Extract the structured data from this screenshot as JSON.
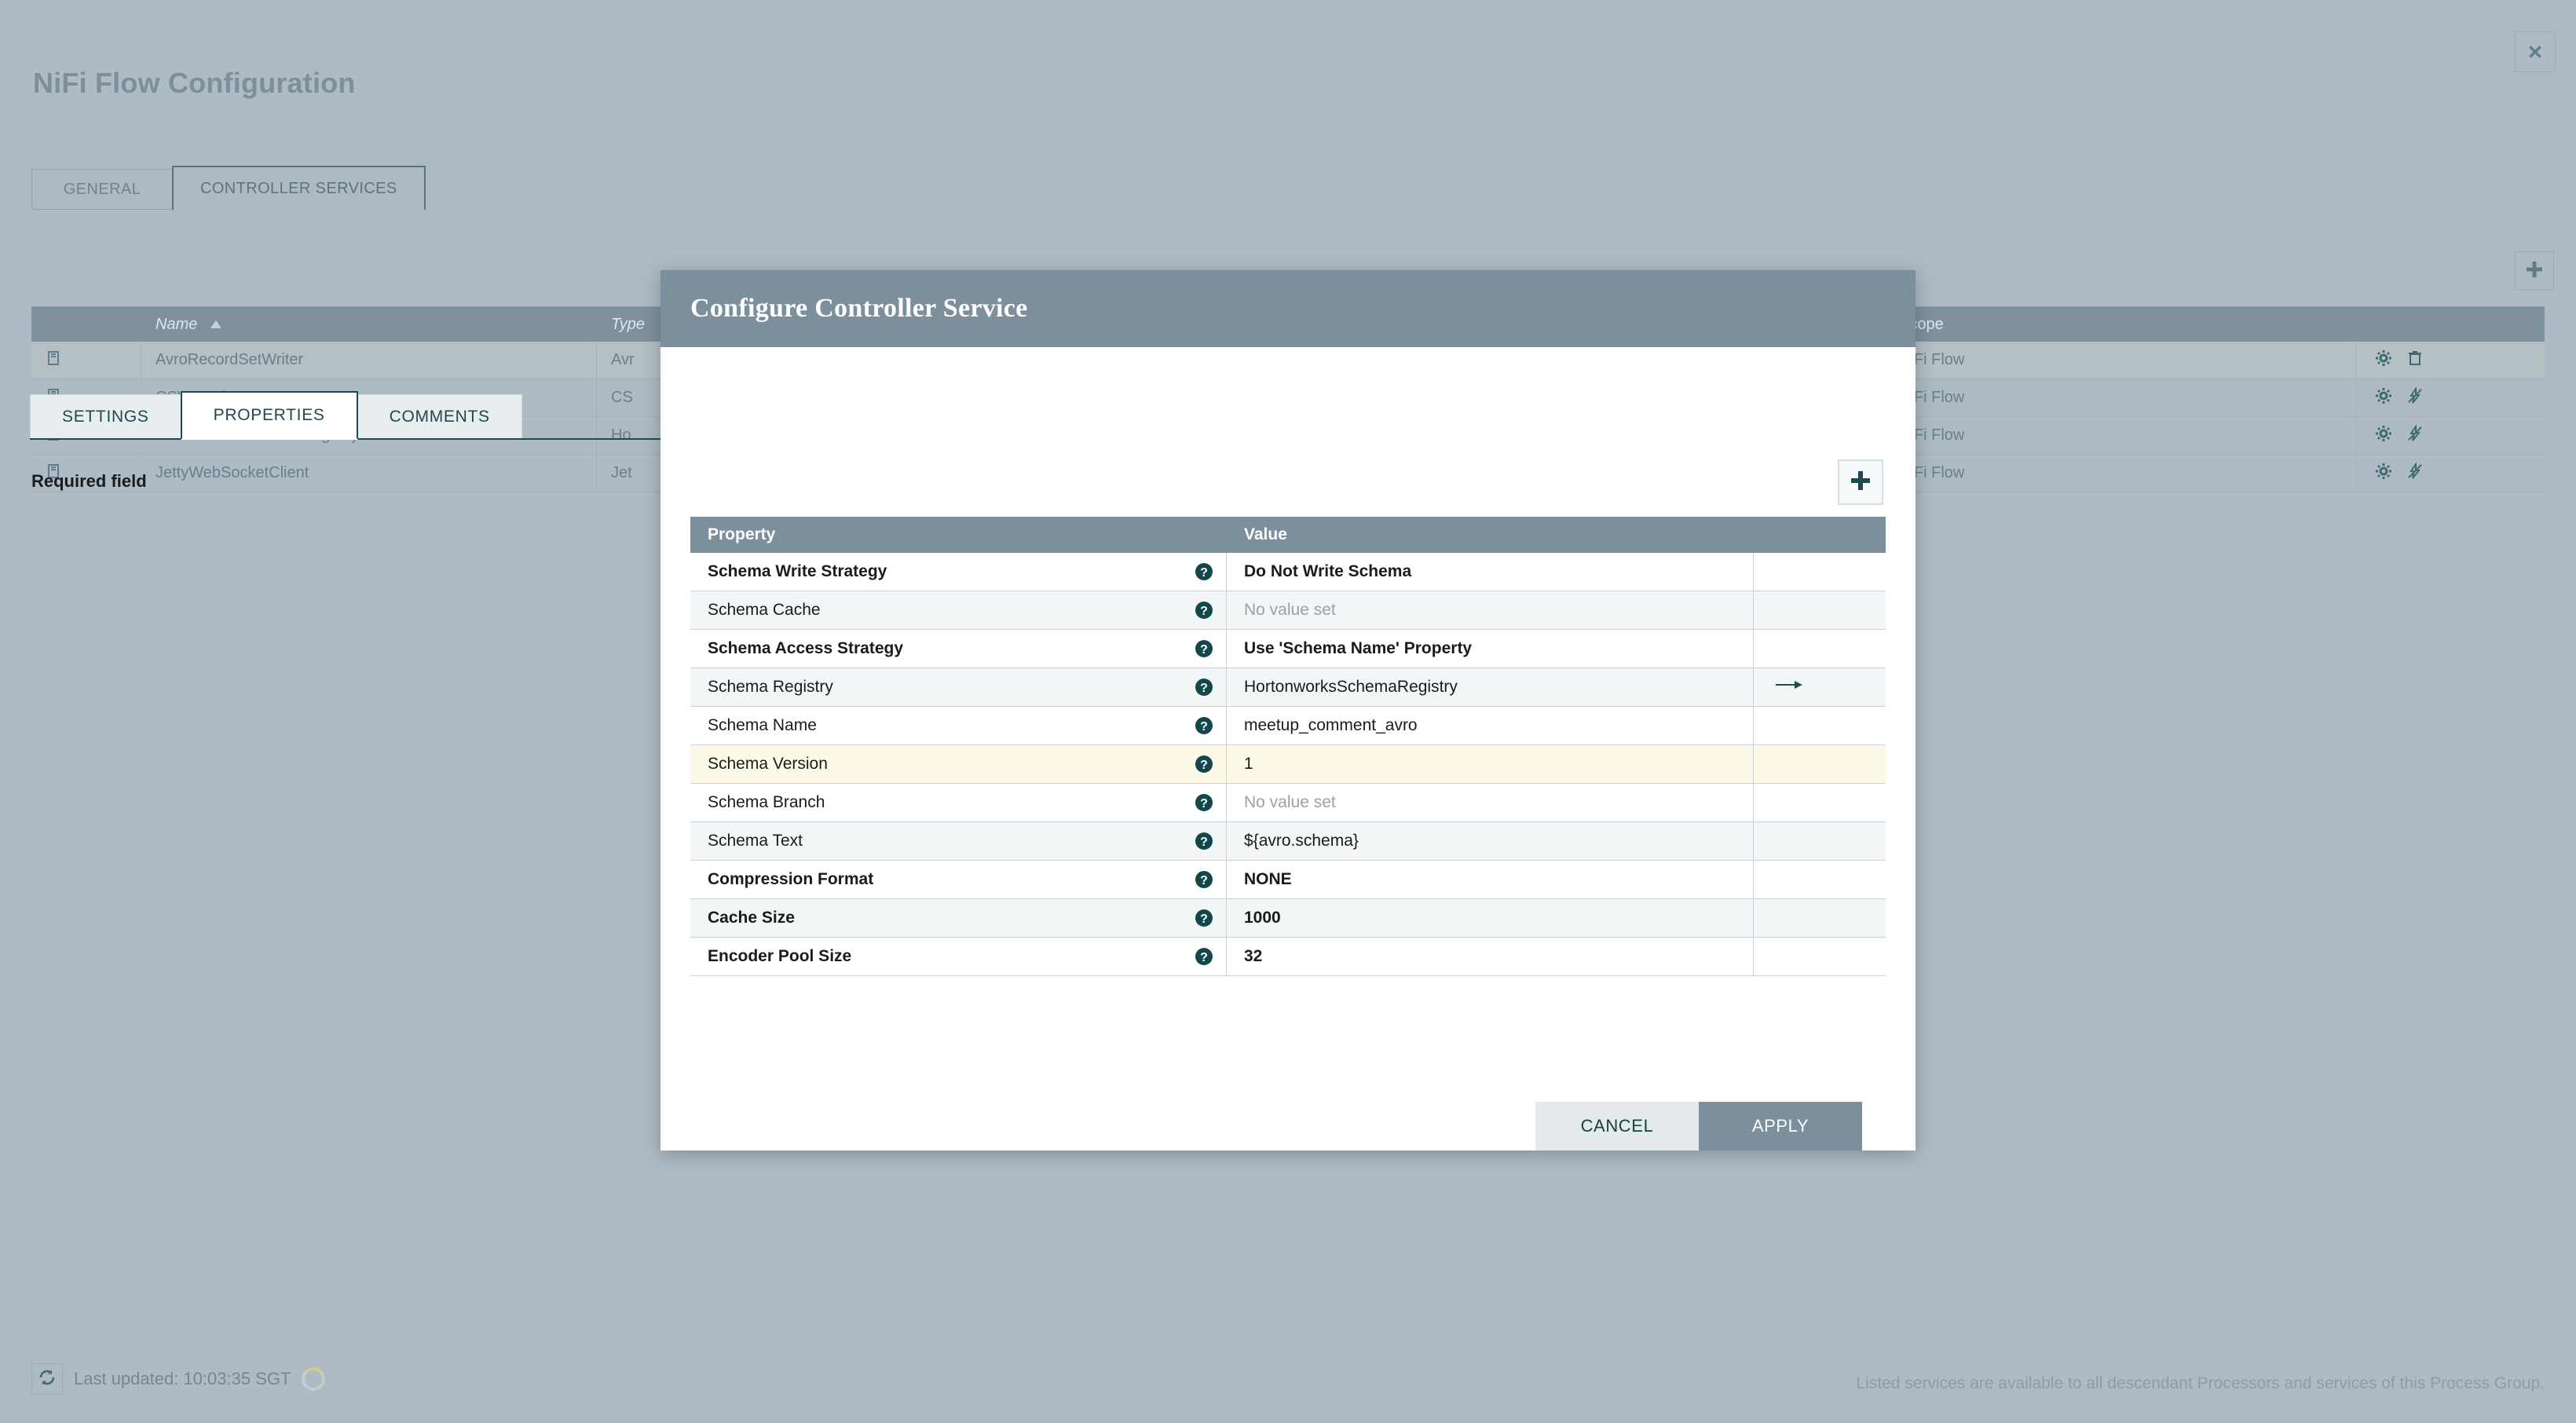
{
  "window": {
    "title": "NiFi Flow Configuration",
    "close_icon": "close-icon"
  },
  "background_tabs": [
    {
      "label": "GENERAL",
      "active": false
    },
    {
      "label": "CONTROLLER SERVICES",
      "active": true
    }
  ],
  "background_toolbar": {
    "add_icon": "plus-icon"
  },
  "services_grid": {
    "columns": [
      "",
      "Name",
      "Type",
      "Scope",
      ""
    ],
    "sort_column": "Name",
    "sort_direction": "asc",
    "rows": [
      {
        "icon": "book-icon",
        "name": "AvroRecordSetWriter",
        "type": "Avr",
        "scope": "NiFi Flow",
        "actions": [
          "gear-icon",
          "trash-icon"
        ]
      },
      {
        "icon": "book-icon",
        "name": "CSVReader",
        "type": "CS",
        "scope": "NiFi Flow",
        "actions": [
          "gear-icon",
          "disable-icon"
        ]
      },
      {
        "icon": "book-icon",
        "name": "HortonworksSchemaRegistry",
        "type": "Ho",
        "scope": "NiFi Flow",
        "actions": [
          "gear-icon",
          "disable-icon"
        ]
      },
      {
        "icon": "book-icon",
        "name": "JettyWebSocketClient",
        "type": "Jet",
        "scope": "NiFi Flow",
        "actions": [
          "gear-icon",
          "disable-icon"
        ]
      }
    ]
  },
  "footer": {
    "refresh_icon": "refresh-icon",
    "last_updated": "Last updated: 10:03:35 SGT",
    "loading_icon": "spinner-icon",
    "note": "Listed services are available to all descendant Processors and services of this Process Group."
  },
  "dialog": {
    "title": "Configure Controller Service",
    "tabs": [
      {
        "label": "SETTINGS",
        "active": false
      },
      {
        "label": "PROPERTIES",
        "active": true
      },
      {
        "label": "COMMENTS",
        "active": false
      }
    ],
    "required_field_label": "Required field",
    "add_property_icon": "plus-icon",
    "table": {
      "columns": [
        "Property",
        "Value",
        ""
      ],
      "rows": [
        {
          "property": "Schema Write Strategy",
          "required": true,
          "value": "Do Not Write Schema",
          "value_empty": false,
          "help_icon": "help-icon",
          "go_to_icon": "",
          "highlight": false,
          "shade": "white"
        },
        {
          "property": "Schema Cache",
          "required": false,
          "value": "No value set",
          "value_empty": true,
          "help_icon": "help-icon",
          "go_to_icon": "",
          "highlight": false,
          "shade": "alt"
        },
        {
          "property": "Schema Access Strategy",
          "required": true,
          "value": "Use 'Schema Name' Property",
          "value_empty": false,
          "help_icon": "help-icon",
          "go_to_icon": "",
          "highlight": false,
          "shade": "white"
        },
        {
          "property": "Schema Registry",
          "required": false,
          "value": "HortonworksSchemaRegistry",
          "value_empty": false,
          "help_icon": "help-icon",
          "go_to_icon": "arrow-right-icon",
          "highlight": false,
          "shade": "alt"
        },
        {
          "property": "Schema Name",
          "required": false,
          "value": "meetup_comment_avro",
          "value_empty": false,
          "help_icon": "help-icon",
          "go_to_icon": "",
          "highlight": false,
          "shade": "white"
        },
        {
          "property": "Schema Version",
          "required": false,
          "value": "1",
          "value_empty": false,
          "help_icon": "help-icon",
          "go_to_icon": "",
          "highlight": true,
          "shade": "highlight"
        },
        {
          "property": "Schema Branch",
          "required": false,
          "value": "No value set",
          "value_empty": true,
          "help_icon": "help-icon",
          "go_to_icon": "",
          "highlight": false,
          "shade": "white"
        },
        {
          "property": "Schema Text",
          "required": false,
          "value": "${avro.schema}",
          "value_empty": false,
          "help_icon": "help-icon",
          "go_to_icon": "",
          "highlight": false,
          "shade": "alt"
        },
        {
          "property": "Compression Format",
          "required": true,
          "value": "NONE",
          "value_empty": false,
          "help_icon": "help-icon",
          "go_to_icon": "",
          "highlight": false,
          "shade": "white"
        },
        {
          "property": "Cache Size",
          "required": true,
          "value": "1000",
          "value_empty": false,
          "help_icon": "help-icon",
          "go_to_icon": "",
          "highlight": false,
          "shade": "alt"
        },
        {
          "property": "Encoder Pool Size",
          "required": true,
          "value": "32",
          "value_empty": false,
          "help_icon": "help-icon",
          "go_to_icon": "",
          "highlight": false,
          "shade": "white"
        }
      ]
    },
    "buttons": {
      "cancel": "CANCEL",
      "apply": "APPLY"
    }
  },
  "colors": {
    "page_bg": "#aebbc4",
    "header_bar": "#7b8f9c",
    "accent_dark": "#1d4b4f",
    "highlight_row": "#fcfae6",
    "alt_row": "#f3f6f7"
  }
}
